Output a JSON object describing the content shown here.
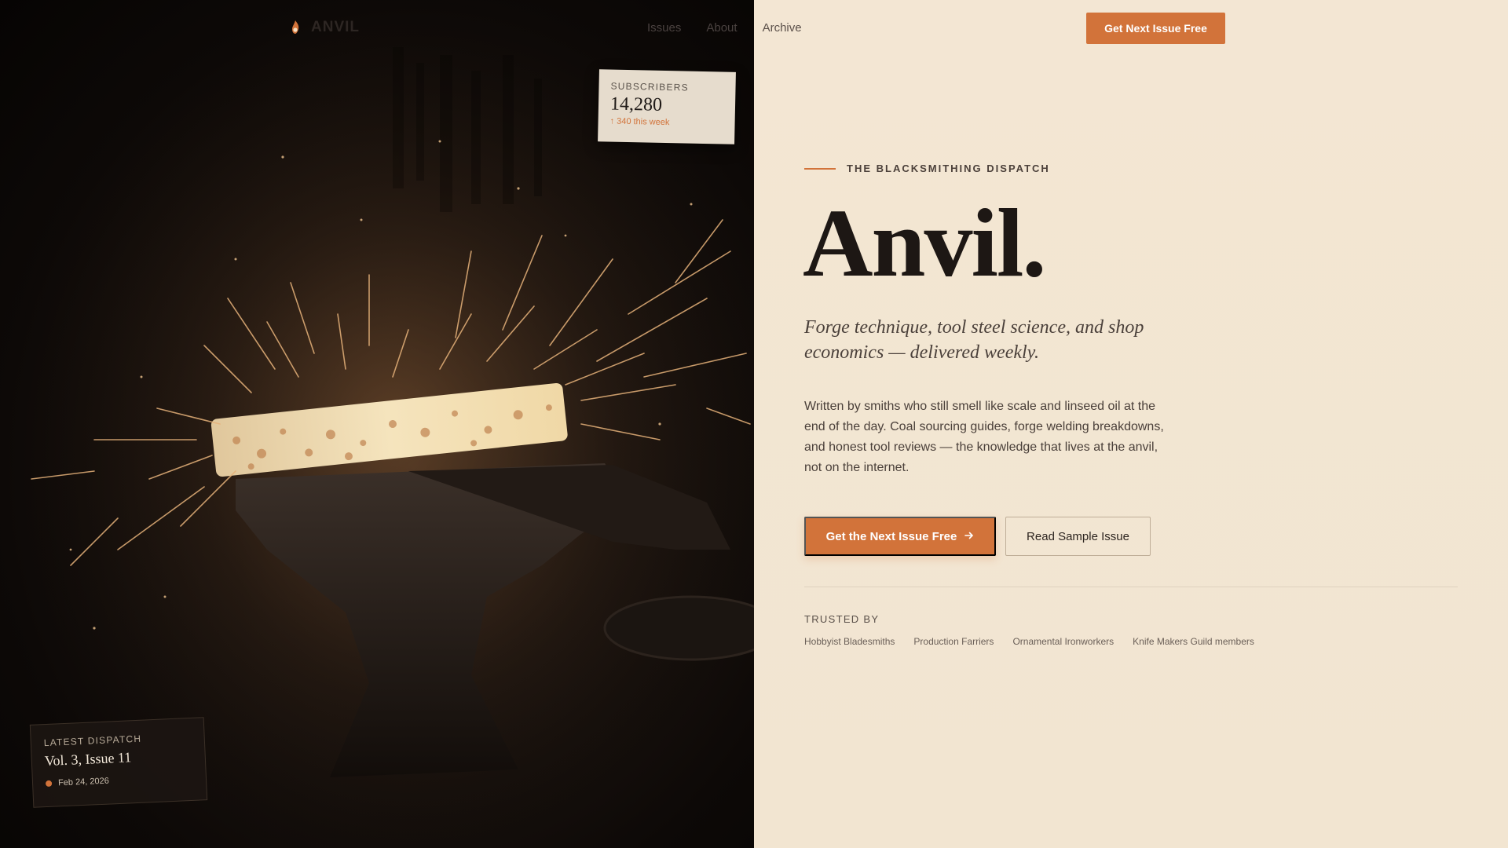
{
  "nav": {
    "brand": "ANVIL",
    "links": [
      "Issues",
      "About",
      "Archive"
    ],
    "cta": "Get Next Issue Free"
  },
  "subscribers_card": {
    "label": "SUBSCRIBERS",
    "count": "14,280",
    "delta": "↑ 340 this week"
  },
  "latest_card": {
    "label": "LATEST DISPATCH",
    "title": "Vol. 3, Issue 11",
    "date": "Feb 24, 2026"
  },
  "hero": {
    "eyebrow": "THE BLACKSMITHING DISPATCH",
    "headline": "Anvil.",
    "subhead": "Forge technique, tool steel science, and shop economics — delivered weekly.",
    "body": "Written by smiths who still smell like scale and linseed oil at the end of the day. Coal sourcing guides, forge welding breakdowns, and honest tool reviews — the knowledge that lives at the anvil, not on the internet.",
    "primary_cta": "Get the Next Issue Free",
    "secondary_cta": "Read Sample Issue"
  },
  "trusted": {
    "label": "TRUSTED BY",
    "items": [
      "Hobbyist Bladesmiths",
      "Production Farriers",
      "Ornamental Ironworkers",
      "Knife Makers Guild members"
    ]
  },
  "colors": {
    "accent": "#d2733a",
    "background": "#f3e6d3",
    "dark": "#0d0907"
  }
}
